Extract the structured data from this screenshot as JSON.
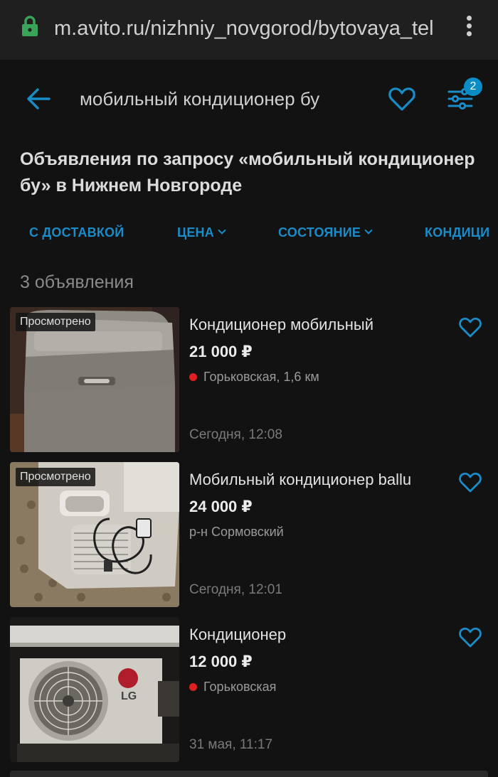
{
  "browser": {
    "url": "m.avito.ru/nizhniy_novgorod/bytovaya_tel",
    "icons": [
      "lock-icon",
      "more-vert-icon"
    ]
  },
  "header": {
    "search_query": "мобильный кондиционер бу",
    "filter_count": "2",
    "accent_color": "#1a8cc8"
  },
  "page": {
    "heading": "Объявления по запросу «мобильный кондиционер бу» в Нижнем Новгороде"
  },
  "filters": {
    "chips": [
      {
        "label": "С ДОСТАВКОЙ"
      },
      {
        "label": "ЦЕНА"
      },
      {
        "label": "СОСТОЯНИЕ"
      },
      {
        "label": "КОНДИЦИ"
      }
    ]
  },
  "results": {
    "count_text": "3 объявления"
  },
  "listings": [
    {
      "badge": "Просмотрено",
      "title": "Кондиционер мобильный",
      "price": "21 000 ₽",
      "location": "Горьковская, 1,6 км",
      "metro_color": "#e02020",
      "date": "Сегодня, 12:08"
    },
    {
      "badge": "Просмотрено",
      "title": "Мобильный кондиционер ballu",
      "price": "24 000 ₽",
      "location": "р-н Сормовский",
      "date": "Сегодня, 12:01"
    },
    {
      "title": "Кондиционер",
      "price": "12 000 ₽",
      "location": "Горьковская",
      "metro_color": "#e02020",
      "date": "31 мая, 11:17",
      "brand_logo": "LG"
    }
  ]
}
